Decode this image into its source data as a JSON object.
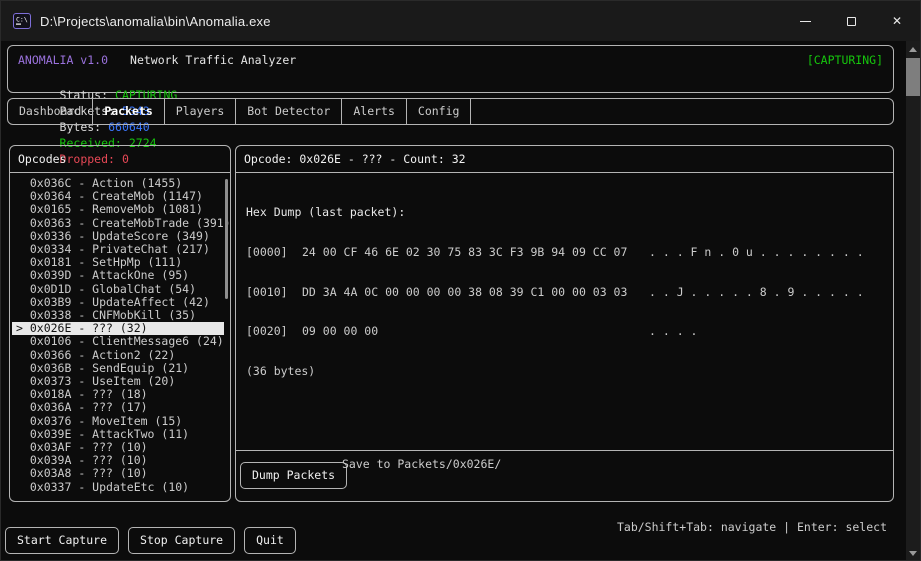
{
  "colors": {
    "bg": "#0C0C0C",
    "titlebar": "#1A1A1A",
    "border": "#B4B4B4",
    "fg": "#CCCCCC",
    "purple": "#9B72DE",
    "green": "#16C60C",
    "blue": "#3B78FF",
    "red": "#E74856",
    "selbg": "#E8E8E8",
    "selfg": "#111111"
  },
  "window": {
    "title": "D:\\Projects\\anomalia\\bin\\Anomalia.exe",
    "close_glyph": "✕"
  },
  "header": {
    "app_name": "ANOMALIA v1.0",
    "app_subtitle": "Network Traffic Analyzer",
    "capture_badge": "[CAPTURING]",
    "status_label": "Status:",
    "status_value": "CAPTURING",
    "packets_label": "Packets:",
    "packets_value": "5343",
    "bytes_label": "Bytes:",
    "bytes_value": "660640",
    "received_label": "Received:",
    "received_value": "2724",
    "dropped_label": "Dropped:",
    "dropped_value": "0"
  },
  "tabs": [
    {
      "label": "Dashboard",
      "active": false
    },
    {
      "label": "Packets",
      "active": true
    },
    {
      "label": "Players",
      "active": false
    },
    {
      "label": "Bot Detector",
      "active": false
    },
    {
      "label": "Alerts",
      "active": false
    },
    {
      "label": "Config",
      "active": false
    }
  ],
  "opcodes_panel": {
    "title": "Opcodes",
    "items": [
      {
        "prefix": "  ",
        "label": "0x036C - Action (1455)",
        "selected": false
      },
      {
        "prefix": "  ",
        "label": "0x0364 - CreateMob (1147)",
        "selected": false
      },
      {
        "prefix": "  ",
        "label": "0x0165 - RemoveMob (1081)",
        "selected": false
      },
      {
        "prefix": "  ",
        "label": "0x0363 - CreateMobTrade (391)",
        "selected": false
      },
      {
        "prefix": "  ",
        "label": "0x0336 - UpdateScore (349)",
        "selected": false
      },
      {
        "prefix": "  ",
        "label": "0x0334 - PrivateChat (217)",
        "selected": false
      },
      {
        "prefix": "  ",
        "label": "0x0181 - SetHpMp (111)",
        "selected": false
      },
      {
        "prefix": "  ",
        "label": "0x039D - AttackOne (95)",
        "selected": false
      },
      {
        "prefix": "  ",
        "label": "0x0D1D - GlobalChat (54)",
        "selected": false
      },
      {
        "prefix": "  ",
        "label": "0x03B9 - UpdateAffect (42)",
        "selected": false
      },
      {
        "prefix": "  ",
        "label": "0x0338 - CNFMobKill (35)",
        "selected": false
      },
      {
        "prefix": "> ",
        "label": "0x026E - ??? (32)",
        "selected": true
      },
      {
        "prefix": "  ",
        "label": "0x0106 - ClientMessage6 (24)",
        "selected": false
      },
      {
        "prefix": "  ",
        "label": "0x0366 - Action2 (22)",
        "selected": false
      },
      {
        "prefix": "  ",
        "label": "0x036B - SendEquip (21)",
        "selected": false
      },
      {
        "prefix": "  ",
        "label": "0x0373 - UseItem (20)",
        "selected": false
      },
      {
        "prefix": "  ",
        "label": "0x018A - ??? (18)",
        "selected": false
      },
      {
        "prefix": "  ",
        "label": "0x036A - ??? (17)",
        "selected": false
      },
      {
        "prefix": "  ",
        "label": "0x0376 - MoveItem (15)",
        "selected": false
      },
      {
        "prefix": "  ",
        "label": "0x039E - AttackTwo (11)",
        "selected": false
      },
      {
        "prefix": "  ",
        "label": "0x03AF - ??? (10)",
        "selected": false
      },
      {
        "prefix": "  ",
        "label": "0x039A - ??? (10)",
        "selected": false
      },
      {
        "prefix": "  ",
        "label": "0x03A8 - ??? (10)",
        "selected": false
      },
      {
        "prefix": "  ",
        "label": "0x0337 - UpdateEtc (10)",
        "selected": false
      }
    ]
  },
  "detail_panel": {
    "title": "Opcode: 0x026E - ??? - Count: 32",
    "hex_dump_label": "Hex Dump (last packet):",
    "hex_rows": [
      {
        "addr": "[0000]",
        "hex": "24 00 CF 46 6E 02 30 75 83 3C F3 9B 94 09 CC 07",
        "ascii": ". . . F n . 0 u . . . . . . . ."
      },
      {
        "addr": "[0010]",
        "hex": "DD 3A 4A 0C 00 00 00 00 38 08 39 C1 00 00 03 03",
        "ascii": ". . J . . . . . 8 . 9 . . . . ."
      },
      {
        "addr": "[0020]",
        "hex": "09 00 00 00",
        "ascii": ". . . ."
      }
    ],
    "byte_count": "(36 bytes)",
    "dump_button": "Dump Packets",
    "save_hint": "Save to Packets/0x026E/"
  },
  "footer": {
    "hint": "Tab/Shift+Tab: navigate | Enter: select",
    "buttons": [
      "Start Capture",
      "Stop Capture",
      "Quit"
    ]
  }
}
